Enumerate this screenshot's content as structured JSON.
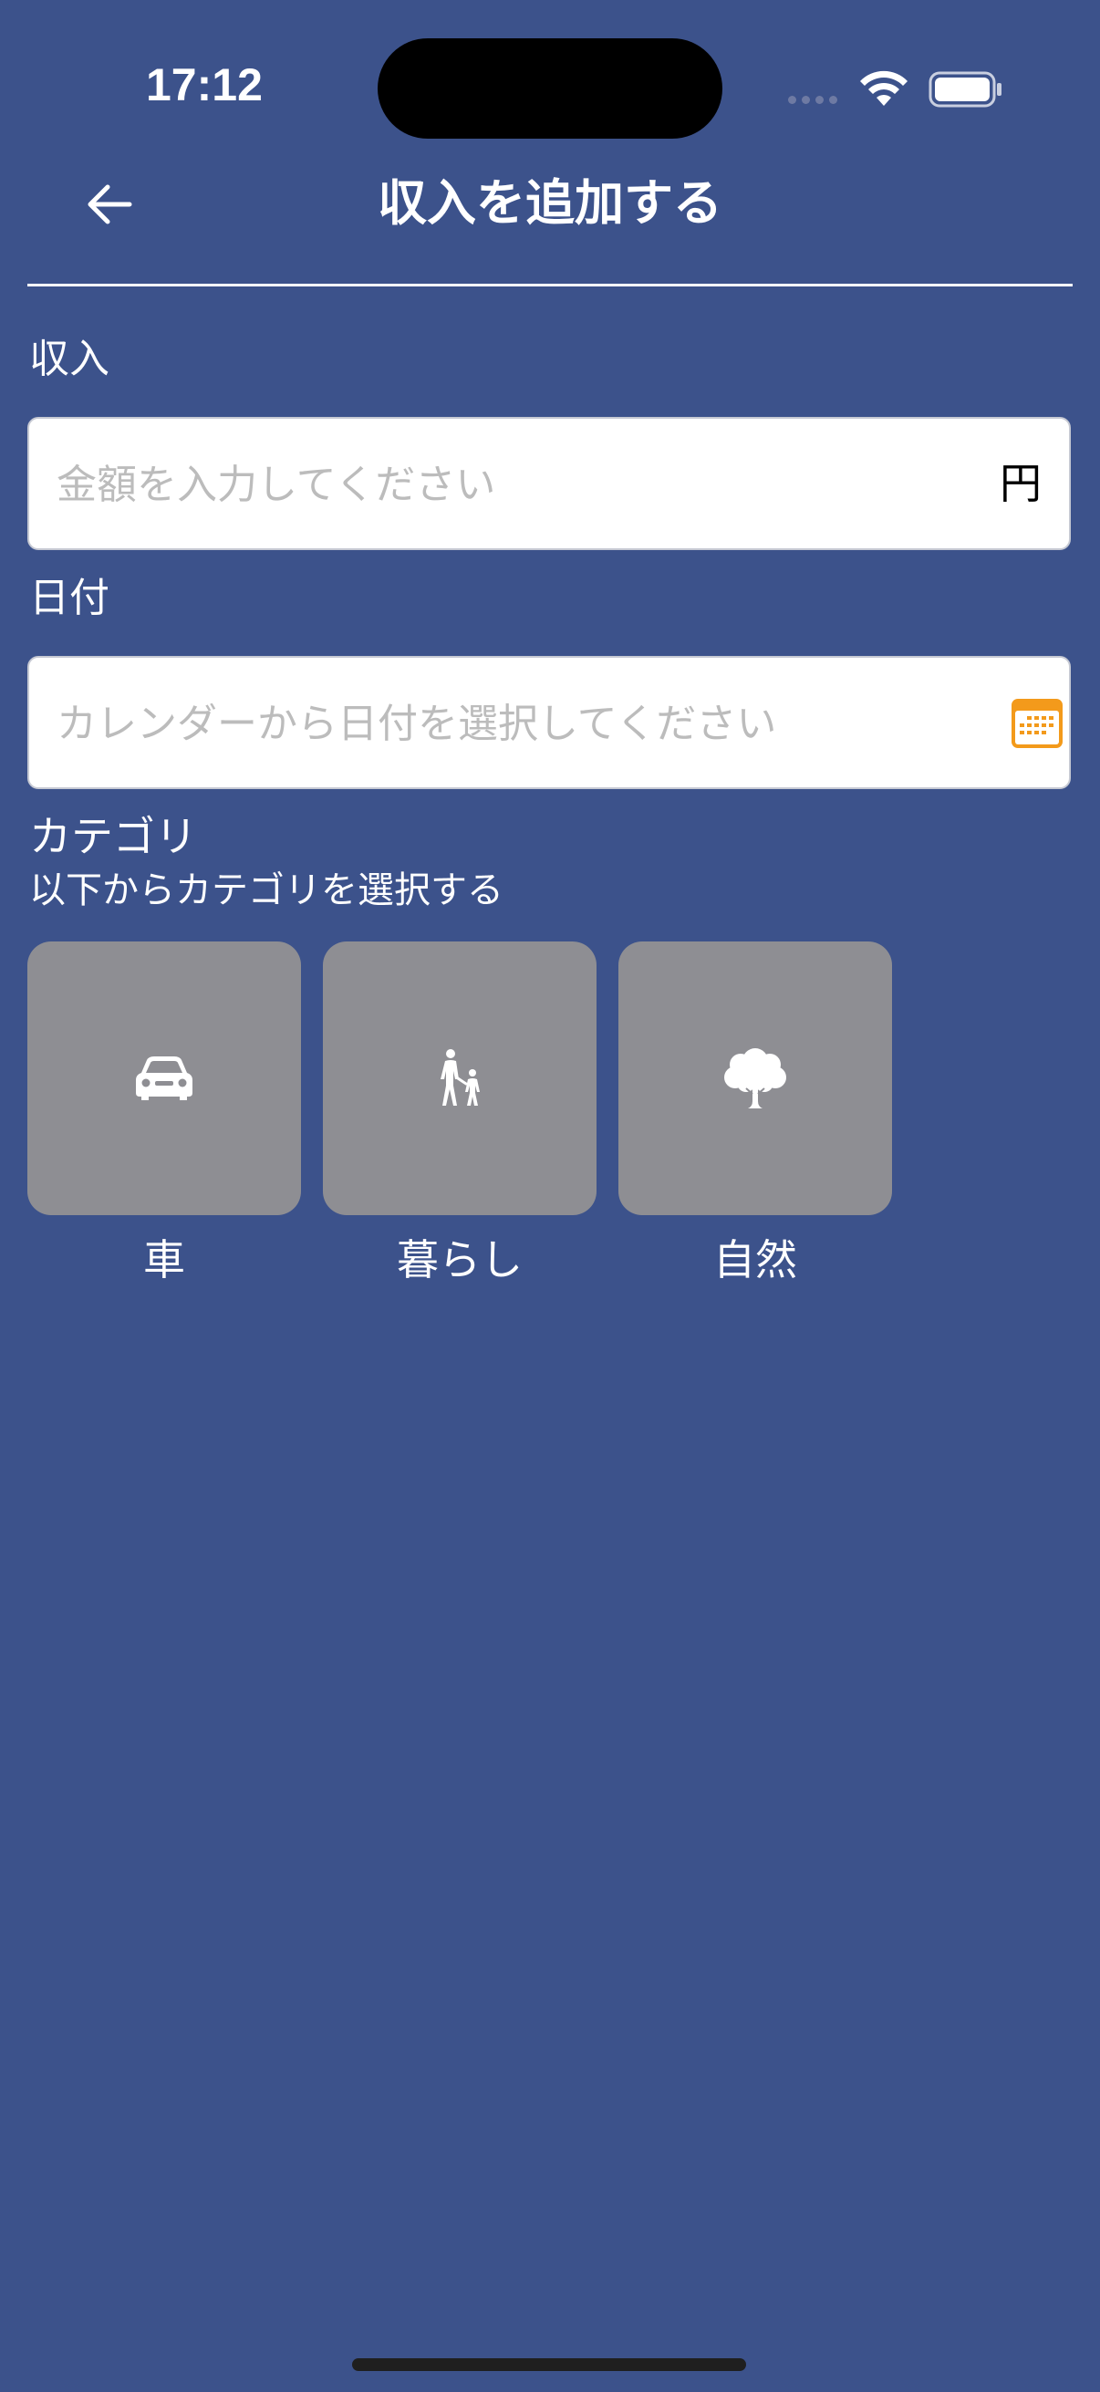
{
  "status_bar": {
    "time": "17:12",
    "icons": [
      "cellular-signal-icon",
      "wifi-icon",
      "battery-icon"
    ]
  },
  "header": {
    "back_icon": "arrow-left-icon",
    "title": "収入を追加する"
  },
  "income": {
    "label": "収入",
    "placeholder": "金額を入力してください",
    "value": "",
    "unit": "円"
  },
  "date": {
    "label": "日付",
    "placeholder": "カレンダーから日付を選択してください",
    "value": "",
    "icon": "calendar-icon"
  },
  "category": {
    "title": "カテゴリ",
    "subtitle": "以下からカテゴリを選択する",
    "items": [
      {
        "label": "車",
        "icon": "car-icon"
      },
      {
        "label": "暮らし",
        "icon": "family-walking-icon"
      },
      {
        "label": "自然",
        "icon": "tree-icon"
      }
    ]
  },
  "colors": {
    "background": "#3c528b",
    "tile": "#8e8e93",
    "accent": "#f39a1b"
  }
}
